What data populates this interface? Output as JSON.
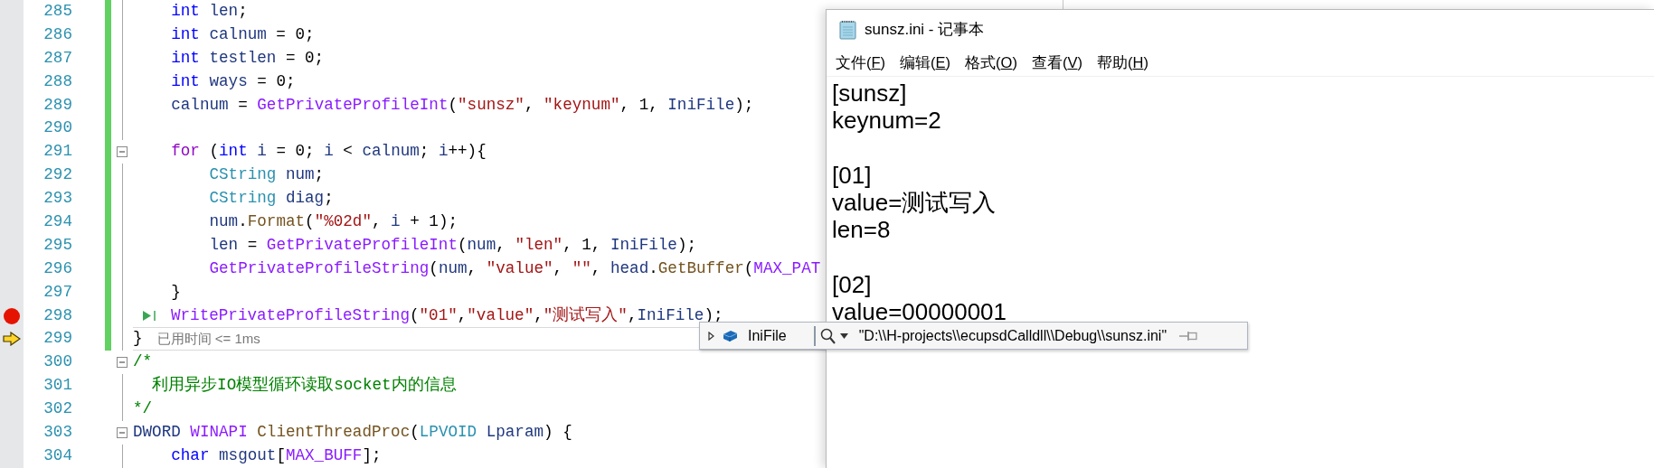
{
  "editor": {
    "lines": [
      {
        "number": "285",
        "changed": true,
        "foldable": false,
        "breakpoint": false,
        "current_statement": false,
        "run_to_click": false,
        "tokens": [
          {
            "kind": "kw",
            "text": "    int"
          },
          {
            "kind": "var",
            "text": " len"
          },
          {
            "kind": "punct",
            "text": ";"
          }
        ]
      },
      {
        "number": "286",
        "changed": true,
        "foldable": false,
        "breakpoint": false,
        "current_statement": false,
        "run_to_click": false,
        "tokens": [
          {
            "kind": "kw",
            "text": "    int"
          },
          {
            "kind": "var",
            "text": " calnum"
          },
          {
            "kind": "punct",
            "text": " = 0;"
          }
        ]
      },
      {
        "number": "287",
        "changed": true,
        "foldable": false,
        "breakpoint": false,
        "current_statement": false,
        "run_to_click": false,
        "tokens": [
          {
            "kind": "kw",
            "text": "    int"
          },
          {
            "kind": "var",
            "text": " testlen"
          },
          {
            "kind": "punct",
            "text": " = 0;"
          }
        ]
      },
      {
        "number": "288",
        "changed": true,
        "foldable": false,
        "breakpoint": false,
        "current_statement": false,
        "run_to_click": false,
        "tokens": [
          {
            "kind": "kw",
            "text": "    int"
          },
          {
            "kind": "var",
            "text": " ways"
          },
          {
            "kind": "punct",
            "text": " = 0;"
          }
        ]
      },
      {
        "number": "289",
        "changed": true,
        "foldable": false,
        "breakpoint": false,
        "current_statement": false,
        "run_to_click": false,
        "tokens": [
          {
            "kind": "var",
            "text": "    calnum"
          },
          {
            "kind": "punct",
            "text": " = "
          },
          {
            "kind": "macro",
            "text": "GetPrivateProfileInt"
          },
          {
            "kind": "punct",
            "text": "("
          },
          {
            "kind": "str",
            "text": "\"sunsz\""
          },
          {
            "kind": "punct",
            "text": ", "
          },
          {
            "kind": "str",
            "text": "\"keynum\""
          },
          {
            "kind": "punct",
            "text": ", 1, "
          },
          {
            "kind": "var",
            "text": "IniFile"
          },
          {
            "kind": "punct",
            "text": ");"
          }
        ]
      },
      {
        "number": "290",
        "changed": true,
        "foldable": false,
        "breakpoint": false,
        "current_statement": false,
        "run_to_click": false
      },
      {
        "number": "291",
        "changed": true,
        "foldable": true,
        "breakpoint": false,
        "current_statement": false,
        "run_to_click": false,
        "tokens": [
          {
            "kind": "ctrl",
            "text": "    for"
          },
          {
            "kind": "punct",
            "text": " ("
          },
          {
            "kind": "kw",
            "text": "int"
          },
          {
            "kind": "var",
            "text": " i"
          },
          {
            "kind": "punct",
            "text": " = 0; "
          },
          {
            "kind": "var",
            "text": "i"
          },
          {
            "kind": "punct",
            "text": " < "
          },
          {
            "kind": "var",
            "text": "calnum"
          },
          {
            "kind": "punct",
            "text": "; "
          },
          {
            "kind": "var",
            "text": "i"
          },
          {
            "kind": "punct",
            "text": "++){"
          }
        ]
      },
      {
        "number": "292",
        "changed": true,
        "foldable": false,
        "breakpoint": false,
        "current_statement": false,
        "run_to_click": false,
        "tokens": [
          {
            "kind": "type",
            "text": "        CString"
          },
          {
            "kind": "var",
            "text": " num"
          },
          {
            "kind": "punct",
            "text": ";"
          }
        ]
      },
      {
        "number": "293",
        "changed": true,
        "foldable": false,
        "breakpoint": false,
        "current_statement": false,
        "run_to_click": false,
        "tokens": [
          {
            "kind": "type",
            "text": "        CString"
          },
          {
            "kind": "var",
            "text": " diag"
          },
          {
            "kind": "punct",
            "text": ";"
          }
        ]
      },
      {
        "number": "294",
        "changed": true,
        "foldable": false,
        "breakpoint": false,
        "current_statement": false,
        "run_to_click": false,
        "tokens": [
          {
            "kind": "var",
            "text": "        num"
          },
          {
            "kind": "punct",
            "text": "."
          },
          {
            "kind": "method",
            "text": "Format"
          },
          {
            "kind": "punct",
            "text": "("
          },
          {
            "kind": "str",
            "text": "\"%02d\""
          },
          {
            "kind": "punct",
            "text": ", "
          },
          {
            "kind": "var",
            "text": "i"
          },
          {
            "kind": "punct",
            "text": " + 1);"
          }
        ]
      },
      {
        "number": "295",
        "changed": true,
        "foldable": false,
        "breakpoint": false,
        "current_statement": false,
        "run_to_click": false,
        "tokens": [
          {
            "kind": "var",
            "text": "        len"
          },
          {
            "kind": "punct",
            "text": " = "
          },
          {
            "kind": "macro",
            "text": "GetPrivateProfileInt"
          },
          {
            "kind": "punct",
            "text": "("
          },
          {
            "kind": "var",
            "text": "num"
          },
          {
            "kind": "punct",
            "text": ", "
          },
          {
            "kind": "str",
            "text": "\"len\""
          },
          {
            "kind": "punct",
            "text": ", 1, "
          },
          {
            "kind": "var",
            "text": "IniFile"
          },
          {
            "kind": "punct",
            "text": ");"
          }
        ]
      },
      {
        "number": "296",
        "changed": true,
        "foldable": false,
        "breakpoint": false,
        "current_statement": false,
        "run_to_click": false,
        "tokens": [
          {
            "kind": "macro",
            "text": "        GetPrivateProfileString"
          },
          {
            "kind": "punct",
            "text": "("
          },
          {
            "kind": "var",
            "text": "num"
          },
          {
            "kind": "punct",
            "text": ", "
          },
          {
            "kind": "str",
            "text": "\"value\""
          },
          {
            "kind": "punct",
            "text": ", "
          },
          {
            "kind": "str",
            "text": "\"\""
          },
          {
            "kind": "punct",
            "text": ", "
          },
          {
            "kind": "var",
            "text": "head"
          },
          {
            "kind": "punct",
            "text": "."
          },
          {
            "kind": "method",
            "text": "GetBuffer"
          },
          {
            "kind": "punct",
            "text": "("
          },
          {
            "kind": "macro",
            "text": "MAX_PAT"
          }
        ]
      },
      {
        "number": "297",
        "changed": true,
        "foldable": false,
        "breakpoint": false,
        "current_statement": false,
        "run_to_click": false,
        "tokens": [
          {
            "kind": "punct",
            "text": "    }"
          }
        ]
      },
      {
        "number": "298",
        "changed": true,
        "foldable": false,
        "breakpoint": true,
        "current_statement": false,
        "run_to_click": true,
        "tokens": [
          {
            "kind": "macro",
            "text": "WritePrivateProfileString"
          },
          {
            "kind": "punct",
            "text": "("
          },
          {
            "kind": "str",
            "text": "\"01\""
          },
          {
            "kind": "punct",
            "text": ","
          },
          {
            "kind": "str",
            "text": "\"value\""
          },
          {
            "kind": "punct",
            "text": ","
          },
          {
            "kind": "str",
            "text": "\"测试写入\""
          },
          {
            "kind": "punct",
            "text": ","
          },
          {
            "kind": "var",
            "text": "IniFile"
          },
          {
            "kind": "punct",
            "text": ");"
          }
        ]
      },
      {
        "number": "299",
        "changed": true,
        "foldable": false,
        "breakpoint": false,
        "current_statement": true,
        "run_to_click": false,
        "tokens": [
          {
            "kind": "punct",
            "text": "}"
          }
        ],
        "perf_tip": "已用时间 <= 1ms"
      },
      {
        "number": "300",
        "changed": false,
        "foldable": true,
        "breakpoint": false,
        "current_statement": false,
        "run_to_click": false,
        "tokens": [
          {
            "kind": "comment",
            "text": "/*"
          }
        ]
      },
      {
        "number": "301",
        "changed": false,
        "foldable": false,
        "breakpoint": false,
        "current_statement": false,
        "run_to_click": false,
        "tokens": [
          {
            "kind": "comment",
            "text": "  利用异步IO模型循环读取socket内的信息"
          }
        ]
      },
      {
        "number": "302",
        "changed": false,
        "foldable": false,
        "breakpoint": false,
        "current_statement": false,
        "run_to_click": false,
        "tokens": [
          {
            "kind": "comment",
            "text": "*/"
          }
        ]
      },
      {
        "number": "303",
        "changed": false,
        "foldable": true,
        "breakpoint": false,
        "current_statement": false,
        "run_to_click": false,
        "tokens": [
          {
            "kind": "var",
            "text": "DWORD"
          },
          {
            "kind": "macro",
            "text": " WINAPI"
          },
          {
            "kind": "method",
            "text": " ClientThreadProc"
          },
          {
            "kind": "punct",
            "text": "("
          },
          {
            "kind": "type",
            "text": "LPVOID"
          },
          {
            "kind": "var",
            "text": " Lparam"
          },
          {
            "kind": "punct",
            "text": ") {"
          }
        ]
      },
      {
        "number": "304",
        "changed": false,
        "foldable": false,
        "breakpoint": false,
        "current_statement": false,
        "run_to_click": false,
        "tokens": [
          {
            "kind": "kw",
            "text": "    char"
          },
          {
            "kind": "var",
            "text": " msgout"
          },
          {
            "kind": "punct",
            "text": "["
          },
          {
            "kind": "macro",
            "text": "MAX_BUFF"
          },
          {
            "kind": "punct",
            "text": "];"
          }
        ]
      }
    ]
  },
  "datatip": {
    "name": "IniFile",
    "value": "\"D:\\\\H-projects\\\\ecupsdCalldll\\\\Debug\\\\sunsz.ini\""
  },
  "notepad": {
    "title": "sunsz.ini - 记事本",
    "menu": [
      {
        "before": "文件(",
        "key": "F",
        "after": ")"
      },
      {
        "before": "编辑(",
        "key": "E",
        "after": ")"
      },
      {
        "before": "格式(",
        "key": "O",
        "after": ")"
      },
      {
        "before": "查看(",
        "key": "V",
        "after": ")"
      },
      {
        "before": "帮助(",
        "key": "H",
        "after": ")"
      }
    ],
    "sections": [
      {
        "header": "[sunsz]",
        "entries": [
          "keynum=2"
        ]
      },
      {
        "header": "[01]",
        "entries": [
          "value=测试写入",
          "len=8"
        ]
      },
      {
        "header": "[02]",
        "entries": [
          "value=00000001"
        ]
      }
    ]
  }
}
